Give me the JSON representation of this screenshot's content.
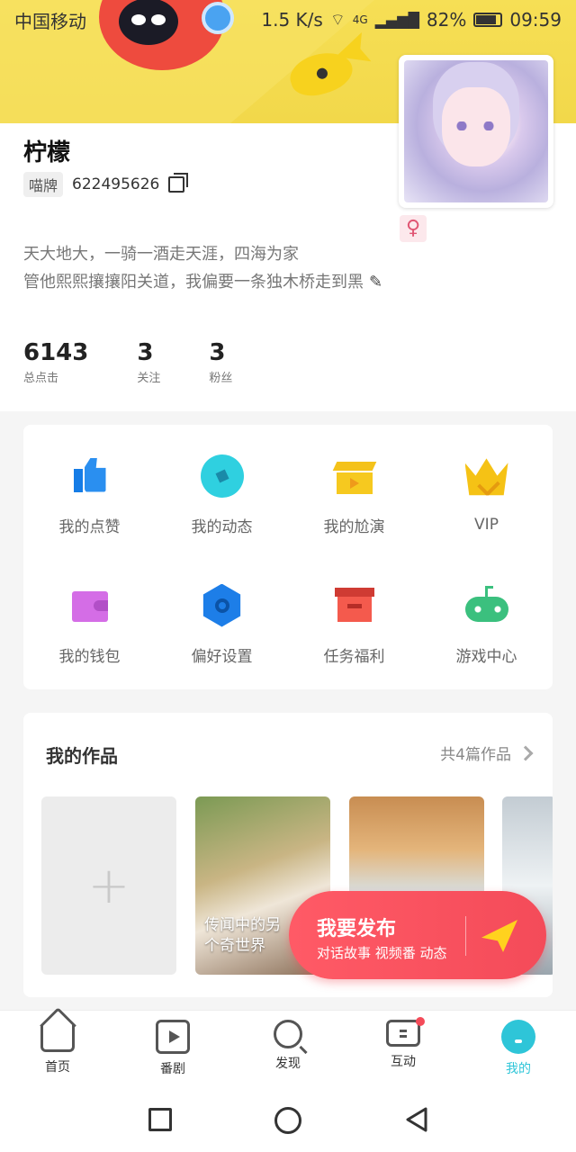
{
  "status_bar": {
    "carrier": "中国移动",
    "speed": "1.5 K/s",
    "network": "4G",
    "battery": "82%",
    "time": "09:59"
  },
  "profile": {
    "name": "柠檬",
    "id_tag": "喵牌",
    "id_number": "622495626",
    "gender_symbol": "♀",
    "bio_line1": "天大地大，一骑一酒走天涯，四海为家",
    "bio_line2": "管他熙熙攘攘阳关道，我偏要一条独木桥走到黑"
  },
  "stats": [
    {
      "value": "6143",
      "label": "总点击"
    },
    {
      "value": "3",
      "label": "关注"
    },
    {
      "value": "3",
      "label": "粉丝"
    }
  ],
  "menu": [
    {
      "label": "我的点赞",
      "icon": "thumbs-up-icon"
    },
    {
      "label": "我的动态",
      "icon": "compass-icon"
    },
    {
      "label": "我的尬演",
      "icon": "clapperboard-icon"
    },
    {
      "label": "VIP",
      "icon": "crown-icon"
    },
    {
      "label": "我的钱包",
      "icon": "wallet-icon"
    },
    {
      "label": "偏好设置",
      "icon": "settings-hex-icon"
    },
    {
      "label": "任务福利",
      "icon": "gift-box-icon"
    },
    {
      "label": "游戏中心",
      "icon": "gamepad-icon"
    }
  ],
  "works": {
    "title": "我的作品",
    "count_label": "共4篇作品",
    "add_symbol": "+",
    "items": [
      {
        "caption_line1": "传闻中的另",
        "caption_line2": "个奇世界"
      }
    ]
  },
  "fab": {
    "title": "我要发布",
    "subtitle": "对话故事 视频番 动态"
  },
  "tabbar": [
    {
      "label": "首页",
      "icon": "home-icon"
    },
    {
      "label": "番剧",
      "icon": "play-square-icon"
    },
    {
      "label": "发现",
      "icon": "search-discover-icon"
    },
    {
      "label": "互动",
      "icon": "chat-icon"
    },
    {
      "label": "我的",
      "icon": "profile-icon"
    }
  ],
  "colors": {
    "banner": "#f2d84a",
    "accent": "#2ec5d8",
    "fab": "#f44b59"
  }
}
